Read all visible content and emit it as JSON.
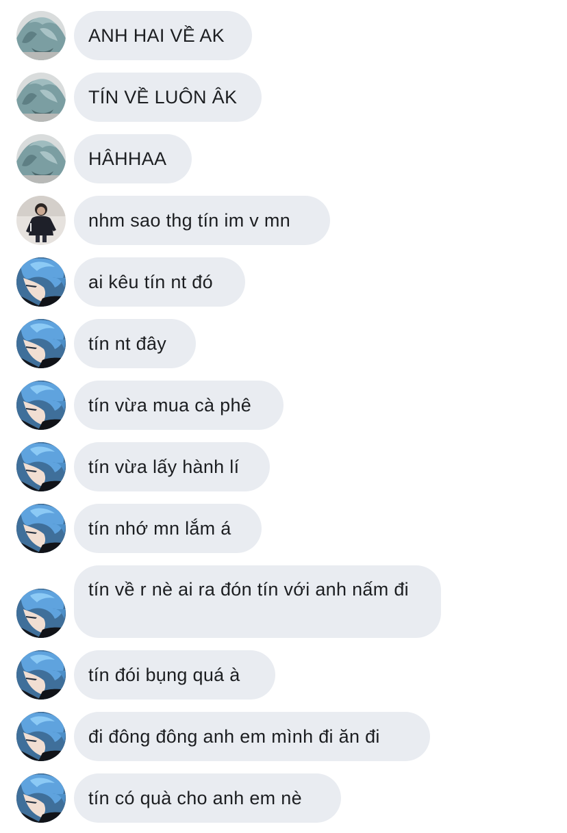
{
  "messages": [
    {
      "sender": "user_a",
      "text": "ANH HAI VỀ AK"
    },
    {
      "sender": "user_a",
      "text": "TÍN VỀ LUÔN ÂK"
    },
    {
      "sender": "user_a",
      "text": "HÂHHAA"
    },
    {
      "sender": "user_b",
      "text": "nhm sao thg tín im v mn"
    },
    {
      "sender": "user_c",
      "text": "ai kêu tín nt đó"
    },
    {
      "sender": "user_c",
      "text": "tín nt đây"
    },
    {
      "sender": "user_c",
      "text": "tín vừa mua cà phê"
    },
    {
      "sender": "user_c",
      "text": "tín vừa lấy hành lí"
    },
    {
      "sender": "user_c",
      "text": "tín nhớ mn lắm á"
    },
    {
      "sender": "user_c",
      "text": "tín về r nè ai ra đón tín với anh nấm đi"
    },
    {
      "sender": "user_c",
      "text": "tín đói bụng quá à"
    },
    {
      "sender": "user_c",
      "text": "đi đông đông anh em mình đi ăn đi"
    },
    {
      "sender": "user_c",
      "text": "tín có quà cho anh em nè"
    }
  ],
  "colors": {
    "bubble_bg": "#e9ecf1",
    "text": "#1c1e21",
    "background": "#ffffff"
  },
  "avatars": {
    "user_a": "grey-blue-hair-avatar-icon",
    "user_b": "dark-clothing-person-avatar-icon",
    "user_c": "blue-hair-avatar-icon"
  }
}
